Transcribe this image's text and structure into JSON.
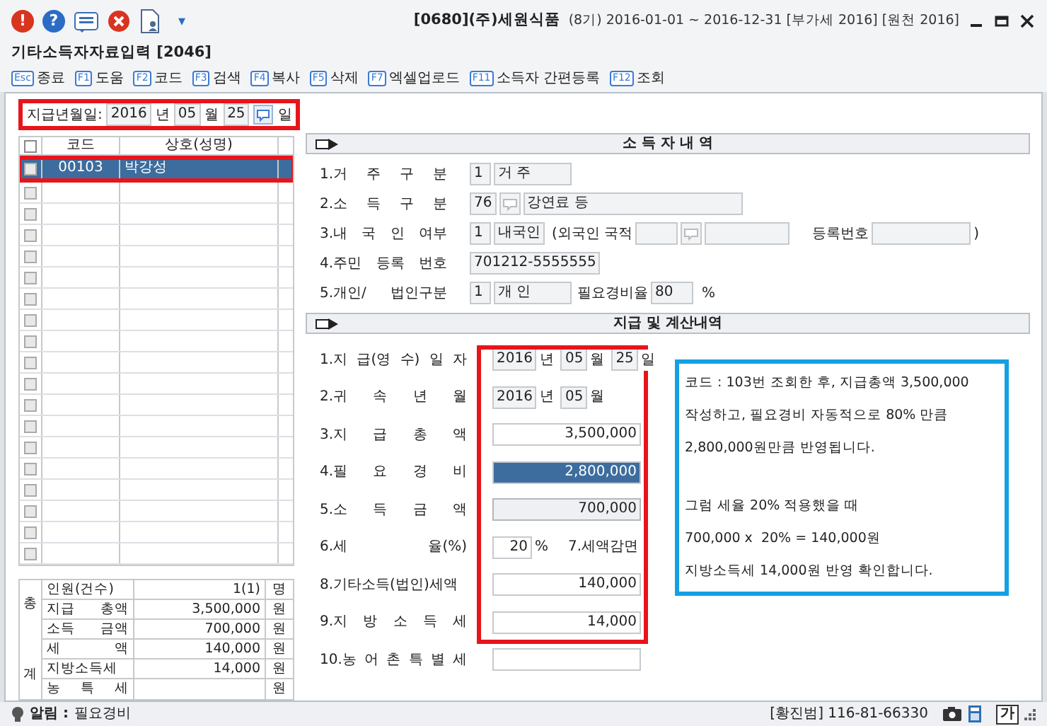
{
  "title_bar": {
    "alert_icon": "!",
    "help_icon": "?",
    "menu_caret": "▾",
    "company": "[0680](주)세원식품",
    "period": "(8기) 2016-01-01 ~ 2016-12-31 [부가세 2016] [원천 2016]"
  },
  "window": {
    "title": "기타소득자자료입력 [2046]"
  },
  "toolbar": [
    {
      "key": "Esc",
      "label": "종료"
    },
    {
      "key": "F1",
      "label": "도움"
    },
    {
      "key": "F2",
      "label": "코드"
    },
    {
      "key": "F3",
      "label": "검색"
    },
    {
      "key": "F4",
      "label": "복사"
    },
    {
      "key": "F5",
      "label": "삭제"
    },
    {
      "key": "F7",
      "label": "엑셀업로드"
    },
    {
      "key": "F11",
      "label": "소득자 간편등록"
    },
    {
      "key": "F12",
      "label": "조회"
    }
  ],
  "date_bar": {
    "label": "지급년월일:",
    "year": "2016",
    "year_unit": "년",
    "month": "05",
    "month_unit": "월",
    "day": "25",
    "day_unit": "일",
    "highlighted": true
  },
  "earner_list": {
    "columns": [
      "코드",
      "상호(성명)"
    ],
    "all_checked": false,
    "rows": [
      {
        "code": "00103",
        "name": "박강성",
        "selected": true,
        "checked": false,
        "highlighted": true
      },
      {
        "selected": false,
        "checked": false
      },
      {
        "selected": false,
        "checked": false
      },
      {
        "selected": false,
        "checked": false
      },
      {
        "selected": false,
        "checked": false
      },
      {
        "selected": false,
        "checked": false
      },
      {
        "selected": false,
        "checked": false
      },
      {
        "selected": false,
        "checked": false
      },
      {
        "selected": false,
        "checked": false
      },
      {
        "selected": false,
        "checked": false
      },
      {
        "selected": false,
        "checked": false
      },
      {
        "selected": false,
        "checked": false
      },
      {
        "selected": false,
        "checked": false
      },
      {
        "selected": false,
        "checked": false
      },
      {
        "selected": false,
        "checked": false
      },
      {
        "selected": false,
        "checked": false
      },
      {
        "selected": false,
        "checked": false
      },
      {
        "selected": false,
        "checked": false
      },
      {
        "selected": false,
        "checked": false
      }
    ]
  },
  "totals": {
    "side_label_top": "총",
    "side_label_bottom": "계",
    "rows": [
      {
        "label": "인원(건수)",
        "value": "1(1)",
        "unit": "명"
      },
      {
        "label": "지급 총액",
        "value": "3,500,000",
        "unit": "원"
      },
      {
        "label": "소득 금액",
        "value": "700,000",
        "unit": "원"
      },
      {
        "label": "세 액",
        "value": "140,000",
        "unit": "원"
      },
      {
        "label": "지방소득세",
        "value": "14,000",
        "unit": "원"
      },
      {
        "label": "농 특 세",
        "unit": "원"
      }
    ]
  },
  "income_earner": {
    "title": "소 득 자 내 역",
    "rows": [
      {
        "label": "1.거 주 구 분",
        "code": "1",
        "value": "거 주"
      },
      {
        "label": "2.소 득 구 분",
        "code": "76",
        "value": "강연료 등"
      },
      {
        "label": "3.내 국 인 여부",
        "code": "1",
        "value": "내국인",
        "nationality_label": "(외국인 국적",
        "reg_label": "등록번호",
        "close": ")"
      },
      {
        "label": "4.주민 등록 번호",
        "value": "701212-5555555"
      },
      {
        "label": "5.개인/ 법인구분",
        "code": "1",
        "value": "개 인",
        "rate_label": "필요경비율",
        "rate": "80",
        "unit": "%"
      }
    ]
  },
  "payment": {
    "title": "지급 및 계산내역",
    "highlighted": true,
    "rows": [
      {
        "kind": "date",
        "label": "1.지 급(영 수) 일 자",
        "year": "2016",
        "year_unit": "년",
        "month": "05",
        "month_unit": "월",
        "day": "25",
        "day_unit": "일"
      },
      {
        "kind": "date",
        "label": "2.귀 속 년 월",
        "year": "2016",
        "year_unit": "년",
        "month": "05",
        "month_unit": "월"
      },
      {
        "kind": "amount",
        "label": "3.지 급 총 액",
        "value": "3,500,000",
        "selected": false,
        "readonly": false
      },
      {
        "kind": "amount",
        "label": "4.필 요 경 비",
        "value": "2,800,000",
        "selected": true,
        "readonly": false
      },
      {
        "kind": "amount",
        "label": "5.소 득 금 액",
        "value": "700,000",
        "selected": false,
        "readonly": true
      },
      {
        "kind": "rate",
        "label": "6.세 율(%)",
        "value": "20",
        "unit": "%",
        "extra_label": "7.세액감면"
      },
      {
        "kind": "amount",
        "label": "8.기타소득(법인)세액",
        "value": "140,000",
        "selected": false,
        "readonly": false
      },
      {
        "kind": "amount",
        "label": "9.지 방 소 득 세",
        "value": "14,000",
        "selected": false,
        "readonly": false
      },
      {
        "kind": "amount",
        "label": "10.농 어 촌 특 별 세",
        "selected": false,
        "readonly": false
      }
    ]
  },
  "note": {
    "paragraphs": [
      [
        "코드 : 103번 조회한 후, 지급총액 3,500,000",
        "작성하고, 필요경비 자동적으로 80% 만큼",
        "2,800,000원만큼 반영됩니다."
      ],
      [
        "그럼 세율 20% 적용했을 때",
        "700,000 x  20% = 140,000원",
        "지방소득세 14,000원 반영 확인합니다."
      ]
    ]
  },
  "status_bar": {
    "alert_label": "알림 :",
    "alert_text": "필요경비",
    "user": "[황진범] 116-81-66330",
    "ime": "가"
  }
}
